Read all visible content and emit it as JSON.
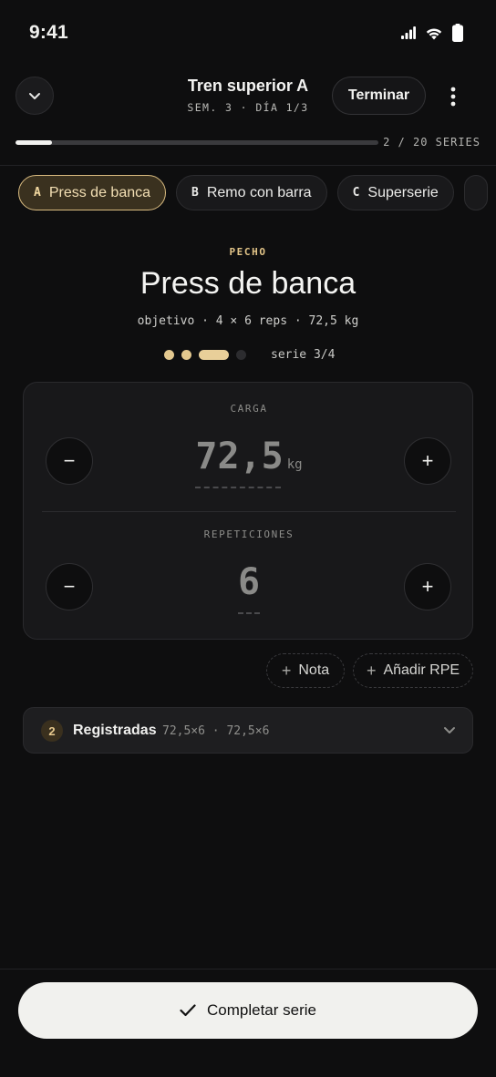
{
  "status_bar": {
    "time": "9:41",
    "icons": [
      "signal-icon",
      "wifi-icon",
      "battery-icon"
    ]
  },
  "header": {
    "collapse_icon": "chevron-down-icon",
    "title": "Tren superior A",
    "subtitle": "SEM. 3 · DÍA 1/3",
    "finish_label": "Terminar",
    "more_icon": "more-vertical-icon"
  },
  "progress": {
    "completed": 2,
    "total": 20,
    "fraction": 0.1,
    "label": "2 / 20 SERIES"
  },
  "exercise_tabs": [
    {
      "letter": "A",
      "label": "Press de banca",
      "active": true
    },
    {
      "letter": "B",
      "label": "Remo con barra",
      "active": false
    },
    {
      "letter": "C",
      "label": "Superserie",
      "active": false
    }
  ],
  "exercise": {
    "muscle_group": "PECHO",
    "name": "Press de banca",
    "objective": "objetivo · 4 × 6 reps · 72,5 kg",
    "sets_total": 4,
    "current_set": 3,
    "set_label": "serie 3/4"
  },
  "inputs": {
    "load": {
      "label": "CARGA",
      "value": "72,5",
      "unit": "kg",
      "decrement": "−",
      "increment": "+"
    },
    "reps": {
      "label": "REPETICIONES",
      "value": "6",
      "decrement": "−",
      "increment": "+"
    }
  },
  "actions": {
    "note": {
      "icon": "+",
      "label": "Nota"
    },
    "rpe": {
      "icon": "+",
      "label": "Añadir RPE"
    }
  },
  "logged": {
    "count": "2",
    "title": "Registradas",
    "sets": "72,5×6 · 72,5×6"
  },
  "cta": {
    "icon": "check-icon",
    "label": "Completar serie"
  },
  "colors": {
    "accent": "#e3c88f",
    "background": "#0e0e0f",
    "cta_bg": "#f1f1ee"
  }
}
